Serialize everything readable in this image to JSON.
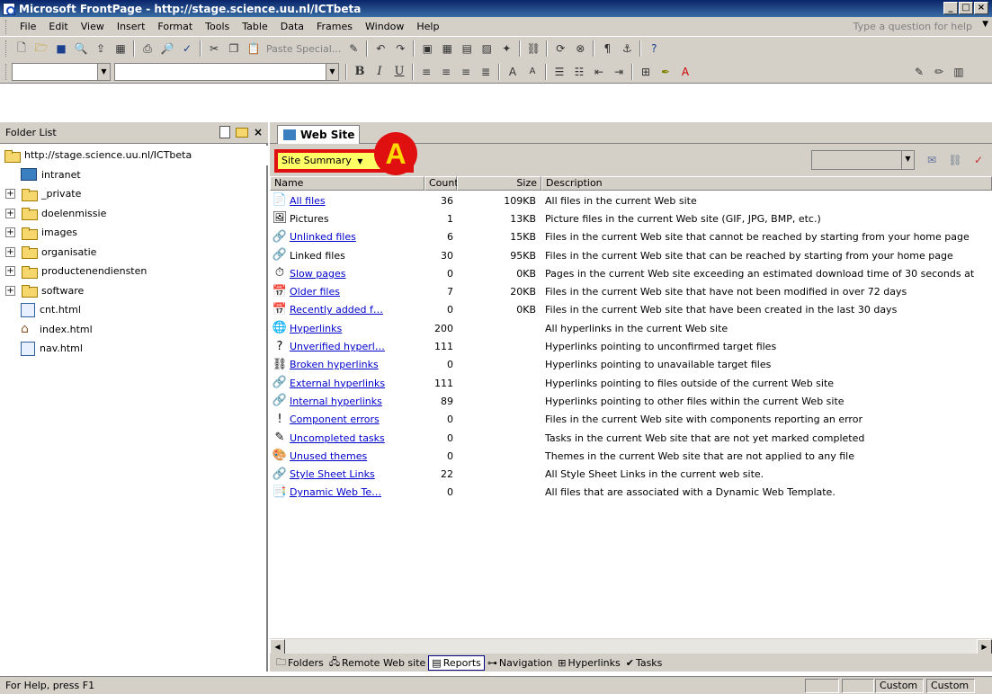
{
  "window": {
    "title": "Microsoft FrontPage - http://stage.science.uu.nl/ICTbeta",
    "min": "_",
    "max": "□",
    "close": "×"
  },
  "menu": {
    "items": [
      "File",
      "Edit",
      "View",
      "Insert",
      "Format",
      "Tools",
      "Table",
      "Data",
      "Frames",
      "Window",
      "Help"
    ],
    "help_placeholder": "Type a question for help"
  },
  "toolbar": {
    "paste_special": "Paste Special..."
  },
  "format_toolbar": {
    "bold": "B",
    "italic": "I",
    "underline": "U"
  },
  "folder_list": {
    "title": "Folder List",
    "root": "http://stage.science.uu.nl/ICTbeta",
    "items": [
      {
        "label": "intranet",
        "type": "web",
        "expand": ""
      },
      {
        "label": "_private",
        "type": "folder",
        "expand": "+"
      },
      {
        "label": "doelenmissie",
        "type": "folder",
        "expand": "+"
      },
      {
        "label": "images",
        "type": "folder",
        "expand": "+"
      },
      {
        "label": "organisatie",
        "type": "folder",
        "expand": "+"
      },
      {
        "label": "productenendiensten",
        "type": "folder",
        "expand": "+"
      },
      {
        "label": "software",
        "type": "folder",
        "expand": "+"
      },
      {
        "label": "cnt.html",
        "type": "page",
        "expand": ""
      },
      {
        "label": "index.html",
        "type": "home",
        "expand": ""
      },
      {
        "label": "nav.html",
        "type": "page",
        "expand": ""
      }
    ]
  },
  "tab": {
    "label": "Web Site"
  },
  "report": {
    "selector": "Site Summary",
    "marker": "A",
    "columns": [
      "Name",
      "Count",
      "Size",
      "Description"
    ],
    "rows": [
      {
        "name": "All files",
        "link": true,
        "icon": "📄",
        "count": "36",
        "size": "109KB",
        "desc": "All files in the current Web site"
      },
      {
        "name": "Pictures",
        "link": false,
        "icon": "🖼",
        "count": "1",
        "size": "13KB",
        "desc": "Picture files in the current Web site (GIF, JPG, BMP, etc.)"
      },
      {
        "name": "Unlinked files",
        "link": true,
        "icon": "🔗",
        "count": "6",
        "size": "15KB",
        "desc": "Files in the current Web site that cannot be reached by starting from your home page"
      },
      {
        "name": "Linked files",
        "link": false,
        "icon": "🔗",
        "count": "30",
        "size": "95KB",
        "desc": "Files in the current Web site that can be reached by starting from your home page"
      },
      {
        "name": "Slow pages",
        "link": true,
        "icon": "⏱",
        "count": "0",
        "size": "0KB",
        "desc": "Pages in the current Web site exceeding an estimated download time of 30 seconds at"
      },
      {
        "name": "Older files",
        "link": true,
        "icon": "📅",
        "count": "7",
        "size": "20KB",
        "desc": "Files in the current Web site that have not been modified in over 72 days"
      },
      {
        "name": "Recently added f…",
        "link": true,
        "icon": "📅",
        "count": "0",
        "size": "0KB",
        "desc": "Files in the current Web site that have been created in the last 30 days"
      },
      {
        "name": "Hyperlinks",
        "link": true,
        "icon": "🌐",
        "count": "200",
        "size": "",
        "desc": "All hyperlinks in the current Web site"
      },
      {
        "name": "Unverified hyperl…",
        "link": true,
        "icon": "?",
        "count": "111",
        "size": "",
        "desc": "Hyperlinks pointing to unconfirmed target files"
      },
      {
        "name": "Broken hyperlinks",
        "link": true,
        "icon": "⛓",
        "count": "0",
        "size": "",
        "desc": "Hyperlinks pointing to unavailable target files"
      },
      {
        "name": "External hyperlinks",
        "link": true,
        "icon": "🔗",
        "count": "111",
        "size": "",
        "desc": "Hyperlinks pointing to files outside of the current Web site"
      },
      {
        "name": "Internal hyperlinks",
        "link": true,
        "icon": "🔗",
        "count": "89",
        "size": "",
        "desc": "Hyperlinks pointing to other files within the current Web site"
      },
      {
        "name": "Component errors",
        "link": true,
        "icon": "!",
        "count": "0",
        "size": "",
        "desc": "Files in the current Web site with components reporting an error"
      },
      {
        "name": "Uncompleted tasks",
        "link": true,
        "icon": "✎",
        "count": "0",
        "size": "",
        "desc": "Tasks in the current Web site that are not yet marked completed"
      },
      {
        "name": "Unused themes",
        "link": true,
        "icon": "🎨",
        "count": "0",
        "size": "",
        "desc": "Themes in the current Web site that are not applied to any file"
      },
      {
        "name": "Style Sheet Links",
        "link": true,
        "icon": "🔗",
        "count": "22",
        "size": "",
        "desc": "All Style Sheet Links in the current web site."
      },
      {
        "name": "Dynamic Web Te…",
        "link": true,
        "icon": "📑",
        "count": "0",
        "size": "",
        "desc": "All files that are associated with a Dynamic Web Template."
      }
    ]
  },
  "views": [
    {
      "label": "Folders",
      "icon": "🗀",
      "active": false
    },
    {
      "label": "Remote Web site",
      "icon": "🖧",
      "active": false
    },
    {
      "label": "Reports",
      "icon": "▤",
      "active": true
    },
    {
      "label": "Navigation",
      "icon": "⊶",
      "active": false
    },
    {
      "label": "Hyperlinks",
      "icon": "⊞",
      "active": false
    },
    {
      "label": "Tasks",
      "icon": "✔",
      "active": false
    }
  ],
  "status": {
    "help": "For Help, press F1",
    "pane1": "Custom",
    "pane2": "Custom"
  },
  "colors": {
    "selector_bg": "#ffff66",
    "highlight_border": "#e01010",
    "link": "#0000cc"
  }
}
